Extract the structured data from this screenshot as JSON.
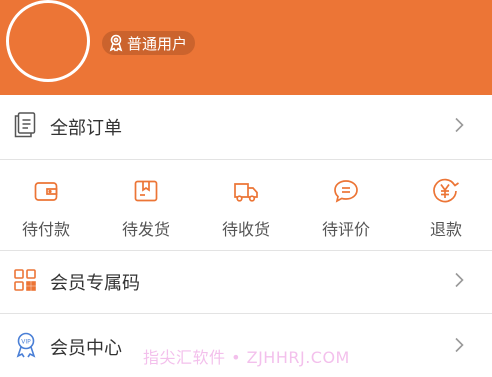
{
  "header": {
    "background_color": "#ec7536",
    "avatar_icon": "avatar-circle",
    "badge": {
      "icon": "ribbon-icon",
      "label": "普通用户"
    }
  },
  "orders_row": {
    "icon": "document-icon",
    "label": "全部订单",
    "chevron": "chevron-right-icon"
  },
  "order_status": [
    {
      "icon": "wallet-icon",
      "label": "待付款"
    },
    {
      "icon": "package-icon",
      "label": "待发货"
    },
    {
      "icon": "truck-icon",
      "label": "待收货"
    },
    {
      "icon": "chat-bubble-icon",
      "label": "待评价"
    },
    {
      "icon": "refund-yen-icon",
      "label": "退款"
    }
  ],
  "member_code_row": {
    "icon": "qr-code-icon",
    "label": "会员专属码",
    "chevron": "chevron-right-icon"
  },
  "member_center_row": {
    "icon": "vip-ribbon-icon",
    "label": "会员中心",
    "chevron": "chevron-right-icon"
  },
  "watermark": "指尖汇软件 • ZJHHRJ.COM",
  "accent_color": "#ec7536"
}
